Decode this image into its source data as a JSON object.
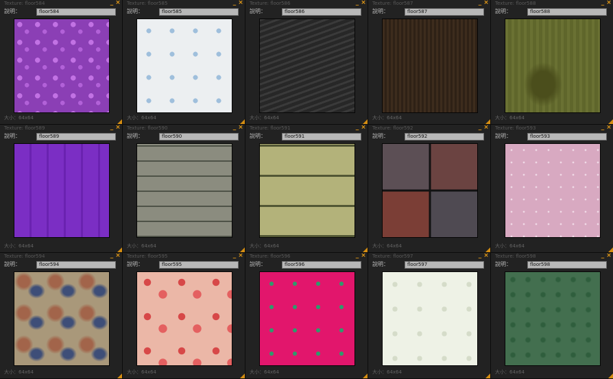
{
  "description_label": "說明：",
  "panels": [
    {
      "title": "Texture: floor584",
      "name": "floor584",
      "size": "大小：64x64"
    },
    {
      "title": "Texture: floor585",
      "name": "floor585",
      "size": "大小：64x64"
    },
    {
      "title": "Texture: floor586",
      "name": "floor586",
      "size": "大小：64x64"
    },
    {
      "title": "Texture: floor587",
      "name": "floor587",
      "size": "大小：64x64"
    },
    {
      "title": "Texture: floor588",
      "name": "floor588",
      "size": "大小：64x64"
    },
    {
      "title": "Texture: floor589",
      "name": "floor589",
      "size": "大小：64x64"
    },
    {
      "title": "Texture: floor590",
      "name": "floor590",
      "size": "大小：64x64"
    },
    {
      "title": "Texture: floor591",
      "name": "floor591",
      "size": "大小：64x64"
    },
    {
      "title": "Texture: floor592",
      "name": "floor592",
      "size": "大小：64x64"
    },
    {
      "title": "Texture: floor593",
      "name": "floor593",
      "size": "大小：64x64"
    },
    {
      "title": "Texture: floor594",
      "name": "floor594",
      "size": "大小：64x64"
    },
    {
      "title": "Texture: floor595",
      "name": "floor595",
      "size": "大小：64x64"
    },
    {
      "title": "Texture: floor596",
      "name": "floor596",
      "size": "大小：64x64"
    },
    {
      "title": "Texture: floor597",
      "name": "floor597",
      "size": "大小：64x64"
    },
    {
      "title": "Texture: floor598",
      "name": "floor598",
      "size": "大小：64x64"
    }
  ],
  "icons": {
    "minimize": "minimize-icon",
    "close": "close-icon",
    "resize": "resize-grip-icon"
  },
  "colors": {
    "accent": "#e79c16",
    "panel_bg": "#222222",
    "field_bg": "#b8b8b8"
  }
}
